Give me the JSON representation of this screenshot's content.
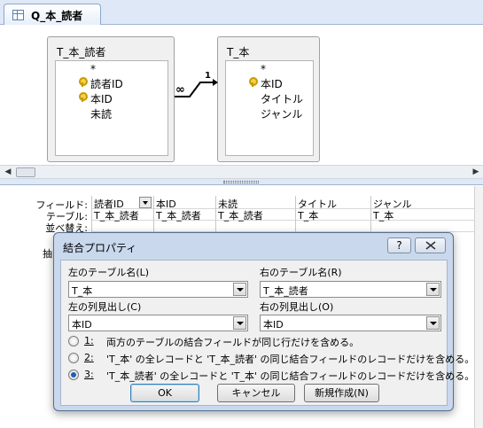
{
  "tab": {
    "label": "Q_本_読者"
  },
  "tables": [
    {
      "title": "T_本_読者",
      "fields": [
        "*",
        "読者ID",
        "本ID",
        "未読"
      ]
    },
    {
      "title": "T_本",
      "fields": [
        "*",
        "本ID",
        "タイトル",
        "ジャンル"
      ]
    }
  ],
  "join": {
    "left_symbol": "∞",
    "right_symbol": "1"
  },
  "grid": {
    "row_labels": [
      "フィールド:",
      "テーブル:",
      "並べ替え:",
      "抽"
    ],
    "columns": [
      {
        "field": "読者ID",
        "table": "T_本_読者"
      },
      {
        "field": "本ID",
        "table": "T_本_読者"
      },
      {
        "field": "未読",
        "table": "T_本_読者"
      },
      {
        "field": "タイトル",
        "table": "T_本"
      },
      {
        "field": "ジャンル",
        "table": "T_本"
      }
    ]
  },
  "dialog": {
    "title": "結合プロパティ",
    "help": "?",
    "left_table_label": "左のテーブル名(L)",
    "left_table_value": "T_本",
    "right_table_label": "右のテーブル名(R)",
    "right_table_value": "T_本_読者",
    "left_column_label": "左の列見出し(C)",
    "left_column_value": "本ID",
    "right_column_label": "右の列見出し(O)",
    "right_column_value": "本ID",
    "options": [
      {
        "num": "1:",
        "text": "両方のテーブルの結合フィールドが同じ行だけを含める。",
        "checked": false
      },
      {
        "num": "2:",
        "text": "'T_本' の全レコードと 'T_本_読者' の同じ結合フィールドのレコードだけを含める。",
        "checked": false
      },
      {
        "num": "3:",
        "text": "'T_本_読者' の全レコードと 'T_本' の同じ結合フィールドのレコードだけを含める。",
        "checked": true
      }
    ],
    "ok": "OK",
    "cancel": "キャンセル",
    "new": "新規作成(N)"
  }
}
